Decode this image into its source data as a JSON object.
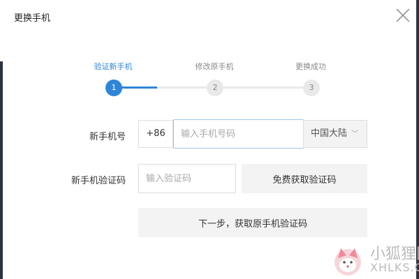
{
  "dialog": {
    "title": "更换手机"
  },
  "steps": [
    {
      "label": "验证新手机",
      "number": "1",
      "state": "active"
    },
    {
      "label": "修改原手机",
      "number": "2",
      "state": "pending"
    },
    {
      "label": "更换成功",
      "number": "3",
      "state": "pending"
    }
  ],
  "colors": {
    "accent": "#2f86d8",
    "idle": "#e9e9e9",
    "button_bg": "#f3f3f3"
  },
  "form": {
    "phone_label": "新手机号",
    "country_code": "+86",
    "phone_placeholder": "输入手机号码",
    "region": "中国大陆",
    "code_label": "新手机验证码",
    "code_placeholder": "输入验证码",
    "get_code_button": "免费获取验证码",
    "next_button": "下一步，获取原手机验证码"
  },
  "watermark": {
    "title": "小狐狸网",
    "subtitle": "XHLKS.CN"
  }
}
